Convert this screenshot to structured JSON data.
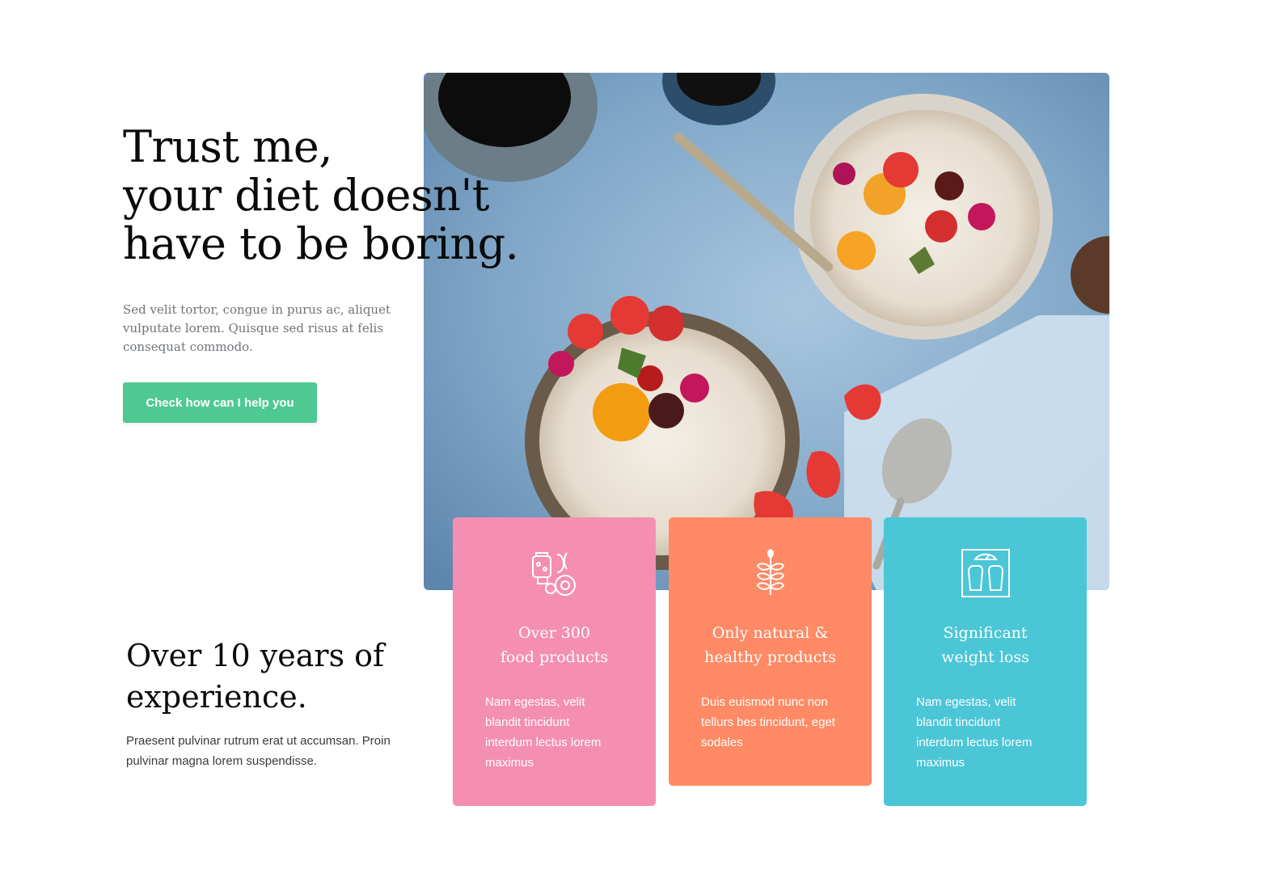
{
  "hero": {
    "title_lines": [
      "Trust me,",
      "your diet doesn't",
      "have to be boring."
    ],
    "text_lines": [
      "Sed velit tortor, congue in purus ac, aliquet",
      "vulputate lorem. Quisque sed risus at felis",
      "consequat commodo."
    ],
    "cta_label": "Check how can I help you"
  },
  "experience": {
    "title_lines": [
      "Over 10 years of",
      "experience."
    ],
    "text_lines": [
      "Praesent pulvinar rutrum erat ut accumsan. Proin",
      "pulvinar magna lorem suspendisse."
    ]
  },
  "cards": [
    {
      "icon": "food-products-icon",
      "color": "#f48fb1",
      "title_lines": [
        "Over 300",
        "food products"
      ],
      "text_lines": [
        "Nam egestas, velit",
        "blandit tincidunt",
        "interdum lectus lorem",
        "maximus"
      ]
    },
    {
      "icon": "wheat-leaf-icon",
      "color": "#ff8a65",
      "title_lines": [
        "Only natural &",
        "healthy products"
      ],
      "text_lines": [
        "Duis euismod nunc non",
        "tellurs bes tincidunt, eget",
        "sodales"
      ]
    },
    {
      "icon": "weight-scale-icon",
      "color": "#4bc6d6",
      "title_lines": [
        "Significant",
        "weight loss"
      ],
      "text_lines": [
        "Nam egestas, velit",
        "blandit tincidunt",
        "interdum lectus lorem",
        "maximus"
      ]
    }
  ]
}
